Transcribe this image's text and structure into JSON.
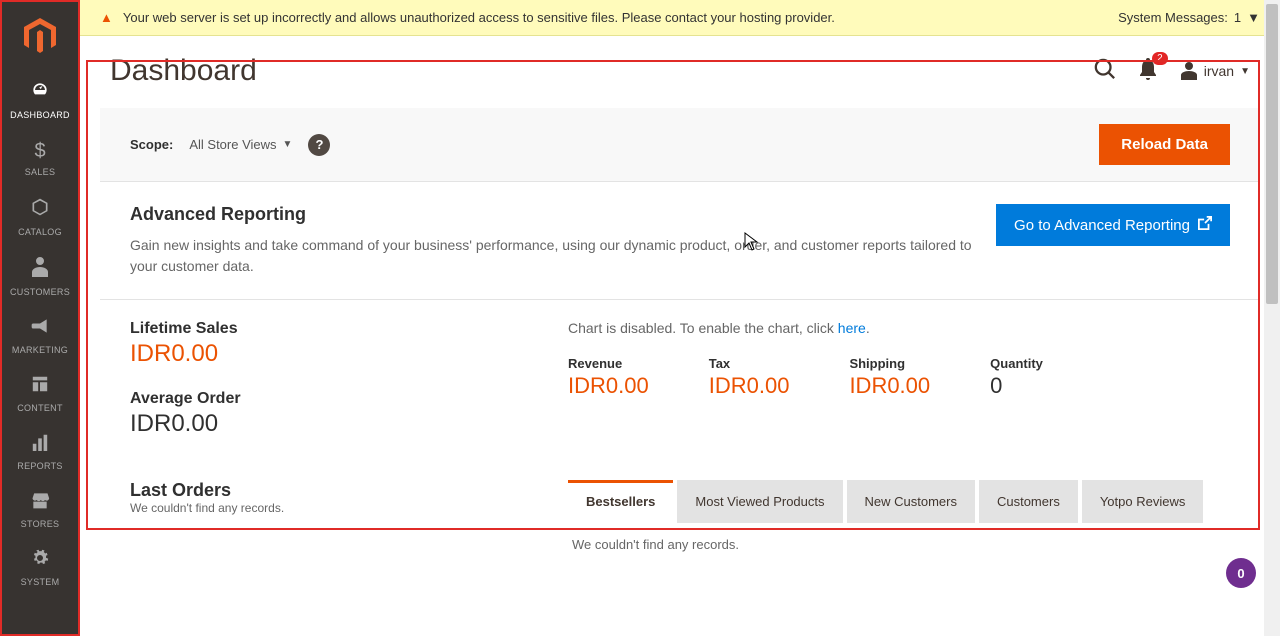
{
  "sysmsg": {
    "text": "Your web server is set up incorrectly and allows unauthorized access to sensitive files. Please contact your hosting provider.",
    "counter_label": "System Messages:",
    "counter": "1"
  },
  "sidebar": {
    "items": [
      {
        "label": "DASHBOARD"
      },
      {
        "label": "SALES"
      },
      {
        "label": "CATALOG"
      },
      {
        "label": "CUSTOMERS"
      },
      {
        "label": "MARKETING"
      },
      {
        "label": "CONTENT"
      },
      {
        "label": "REPORTS"
      },
      {
        "label": "STORES"
      },
      {
        "label": "SYSTEM"
      }
    ]
  },
  "header": {
    "title": "Dashboard",
    "notification_count": "2",
    "user": "irvan"
  },
  "scope": {
    "label": "Scope:",
    "value": "All Store Views",
    "reload": "Reload Data"
  },
  "adv": {
    "title": "Advanced Reporting",
    "desc": "Gain new insights and take command of your business' performance, using our dynamic product, order, and customer reports tailored to your customer data.",
    "button": "Go to Advanced Reporting"
  },
  "stats": {
    "lifetime_label": "Lifetime Sales",
    "lifetime_value": "IDR0.00",
    "avg_label": "Average Order",
    "avg_value": "IDR0.00",
    "chart_msg_pre": "Chart is disabled. To enable the chart, click ",
    "chart_link": "here",
    "chart_msg_post": ".",
    "metrics": [
      {
        "label": "Revenue",
        "value": "IDR0.00",
        "dark": false
      },
      {
        "label": "Tax",
        "value": "IDR0.00",
        "dark": false
      },
      {
        "label": "Shipping",
        "value": "IDR0.00",
        "dark": false
      },
      {
        "label": "Quantity",
        "value": "0",
        "dark": true
      }
    ]
  },
  "last_orders": {
    "title": "Last Orders",
    "empty": "We couldn't find any records."
  },
  "tabs": {
    "items": [
      {
        "label": "Bestsellers"
      },
      {
        "label": "Most Viewed Products"
      },
      {
        "label": "New Customers"
      },
      {
        "label": "Customers"
      },
      {
        "label": "Yotpo Reviews"
      }
    ],
    "empty": "We couldn't find any records."
  },
  "float_badge": "0"
}
